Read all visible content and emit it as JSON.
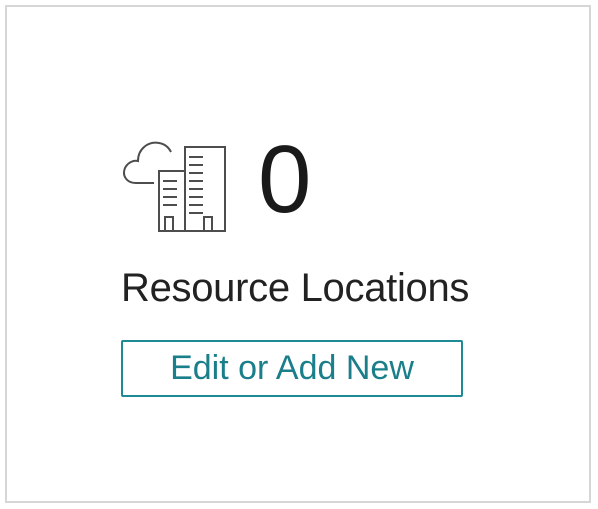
{
  "widget": {
    "icon": "cloud-buildings-icon",
    "count": "0",
    "label": "Resource Locations",
    "button_label": "Edit or Add New",
    "accent_color": "#1f8a94",
    "icon_color": "#4d4d4d"
  }
}
